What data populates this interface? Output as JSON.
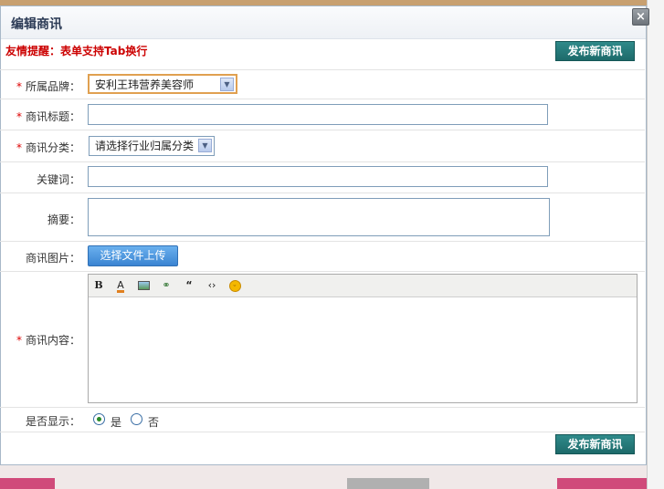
{
  "dialog": {
    "title": "编辑商讯",
    "close_label": "×",
    "tip": "友情提醒：表单支持Tab换行",
    "publish_label": "发布新商讯"
  },
  "form": {
    "required_mark": "*",
    "brand": {
      "label": "所属品牌：",
      "value": "安利王玮营养美容师"
    },
    "title": {
      "label": "商讯标题：",
      "value": ""
    },
    "category": {
      "label": "商讯分类：",
      "value": "请选择行业归属分类"
    },
    "keywords": {
      "label": "关键词：",
      "value": ""
    },
    "summary": {
      "label": "摘要：",
      "value": ""
    },
    "image": {
      "label": "商讯图片：",
      "button": "选择文件上传"
    },
    "content": {
      "label": "商讯内容：",
      "toolbar": [
        "bold-icon",
        "font-color-icon",
        "image-icon",
        "link-icon",
        "quote-icon",
        "code-icon",
        "emoticon-icon"
      ]
    },
    "display": {
      "label": "是否显示：",
      "yes": "是",
      "no": "否",
      "selected": "是"
    }
  },
  "colors": {
    "accent": "#1d6a6a",
    "tip": "#cc0000",
    "required": "#dd0000",
    "upload": "#3a84d2"
  }
}
